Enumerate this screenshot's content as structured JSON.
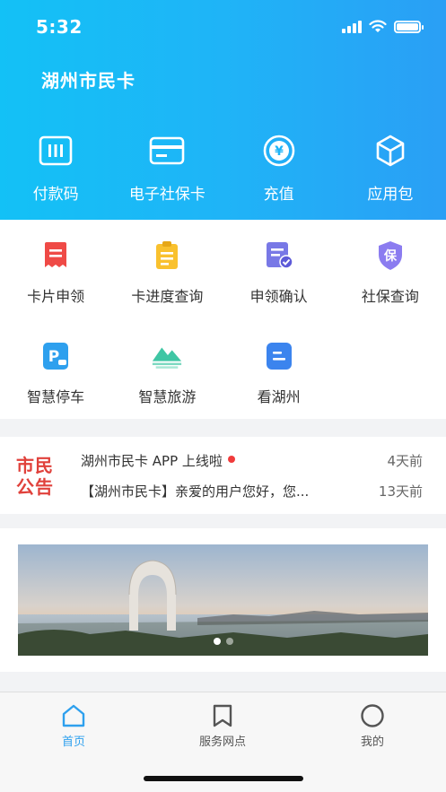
{
  "status_bar": {
    "time": "5:32"
  },
  "header": {
    "title": "湖州市民卡",
    "actions": [
      {
        "label": "付款码",
        "icon": "payment-code-icon"
      },
      {
        "label": "电子社保卡",
        "icon": "e-social-card-icon"
      },
      {
        "label": "充值",
        "icon": "recharge-yen-icon"
      },
      {
        "label": "应用包",
        "icon": "app-package-icon"
      }
    ]
  },
  "services": {
    "row1": [
      {
        "label": "卡片申领",
        "icon": "card-apply-icon"
      },
      {
        "label": "卡进度查询",
        "icon": "progress-query-icon"
      },
      {
        "label": "申领确认",
        "icon": "apply-confirm-icon"
      },
      {
        "label": "社保查询",
        "icon": "social-security-icon",
        "badge": "保"
      }
    ],
    "row2": [
      {
        "label": "智慧停车",
        "icon": "smart-parking-icon",
        "badge": "P"
      },
      {
        "label": "智慧旅游",
        "icon": "smart-tourism-icon"
      },
      {
        "label": "看湖州",
        "icon": "view-huzhou-icon"
      }
    ]
  },
  "notice": {
    "logo_line1": "市民",
    "logo_line2": "公告",
    "items": [
      {
        "title": "湖州市民卡 APP 上线啦",
        "date": "4天前",
        "unread": true
      },
      {
        "title": "【湖州市民卡】亲爱的用户您好，您...",
        "date": "13天前",
        "unread": false
      }
    ]
  },
  "banner": {
    "alt": "湖州月亮酒店风景",
    "slide_count": 2,
    "active_slide": 1
  },
  "tabbar": {
    "items": [
      {
        "label": "首页",
        "icon": "home-icon",
        "active": true
      },
      {
        "label": "服务网点",
        "icon": "bookmark-icon",
        "active": false
      },
      {
        "label": "我的",
        "icon": "profile-circle-icon",
        "active": false
      }
    ]
  },
  "colors": {
    "header_start": "#13c1f6",
    "header_end": "#2a9ff5",
    "accent": "#2ea0ee",
    "notice_red": "#e0413b"
  }
}
